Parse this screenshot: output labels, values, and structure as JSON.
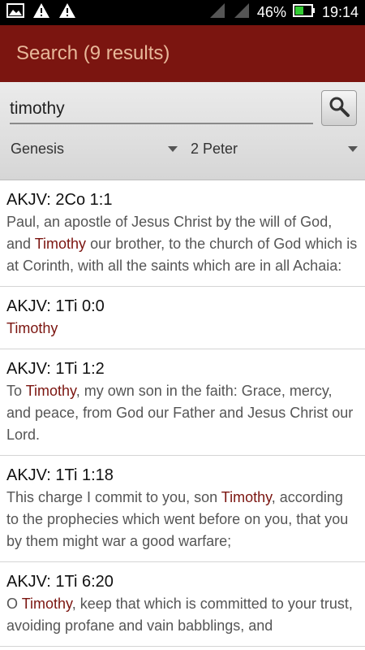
{
  "status_bar": {
    "battery_percent": "46%",
    "time": "19:14",
    "icons": [
      "image-icon",
      "warning-icon",
      "warning-icon",
      "signal-icon",
      "signal-icon",
      "battery-icon"
    ]
  },
  "app_bar": {
    "title": "Search (9 results)"
  },
  "search": {
    "query": "timothy",
    "button_icon": "magnifier-icon",
    "from_book": "Genesis",
    "to_book": "2 Peter"
  },
  "colors": {
    "app_bar": "#7b1510",
    "title_text": "#e8b89a",
    "highlight": "#7b1510"
  },
  "results": [
    {
      "ref": "AKJV: 2Co 1:1",
      "segments": [
        {
          "t": "Paul, an apostle of Jesus Christ by the will of God, and "
        },
        {
          "t": "Timothy",
          "hl": true
        },
        {
          "t": " our brother, to the church of God which is at Corinth, with all the saints which are in all Achaia:"
        }
      ]
    },
    {
      "ref": "AKJV: 1Ti 0:0",
      "segments": [
        {
          "t": "Timothy",
          "hl": true
        }
      ]
    },
    {
      "ref": "AKJV: 1Ti 1:2",
      "segments": [
        {
          "t": "To "
        },
        {
          "t": "Timothy",
          "hl": true
        },
        {
          "t": ", my own son in the faith: Grace, mercy, and peace, from God our Father and Jesus Christ our Lord."
        }
      ]
    },
    {
      "ref": "AKJV: 1Ti 1:18",
      "segments": [
        {
          "t": "This charge I commit to you, son "
        },
        {
          "t": "Timothy",
          "hl": true
        },
        {
          "t": ", according to the prophecies which went before on you, that you by them might war a good warfare;"
        }
      ]
    },
    {
      "ref": "AKJV: 1Ti 6:20",
      "segments": [
        {
          "t": "O "
        },
        {
          "t": "Timothy",
          "hl": true
        },
        {
          "t": ", keep that which is committed to your trust, avoiding profane and vain babblings, and"
        }
      ]
    }
  ]
}
